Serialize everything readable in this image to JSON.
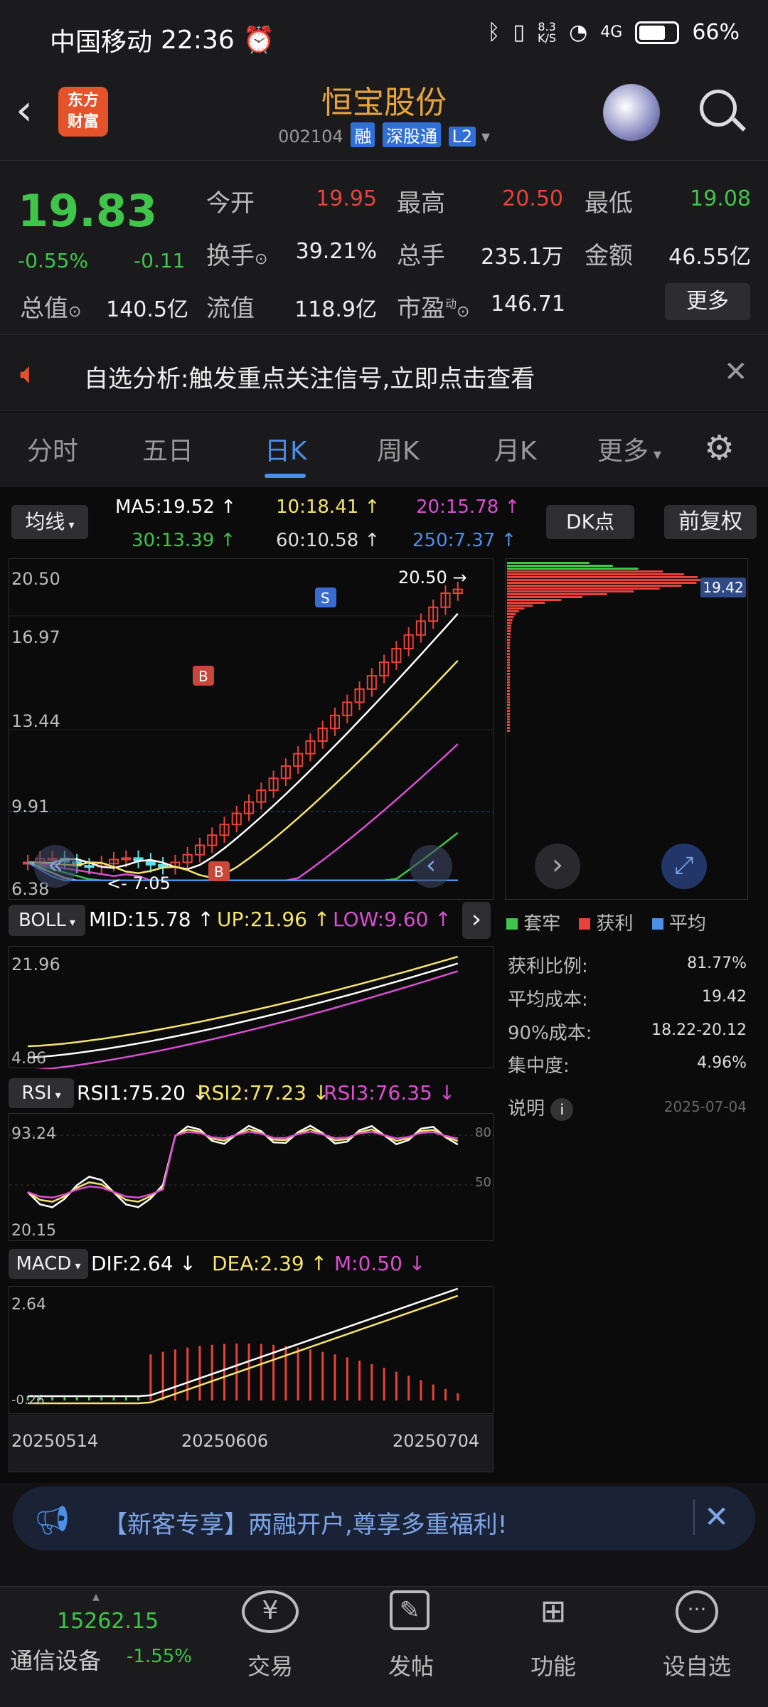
{
  "status": {
    "carrier": "中国移动",
    "time": "22:36",
    "net_speed_top": "8.3",
    "net_speed_unit": "K/S",
    "network": "4G",
    "battery": "66%"
  },
  "header": {
    "logo_line1": "东方",
    "logo_line2": "财富",
    "stock_name": "恒宝股份",
    "stock_code": "002104",
    "tag_rong": "融",
    "tag_shen": "深股通",
    "tag_level": "L2"
  },
  "quote": {
    "price": "19.83",
    "pct_change": "-0.55%",
    "abs_change": "-0.11",
    "open_label": "今开",
    "open_value": "19.95",
    "high_label": "最高",
    "high_value": "20.50",
    "low_label": "最低",
    "low_value": "19.08",
    "turnover_label": "换手",
    "turnover_value": "39.21%",
    "volume_label": "总手",
    "volume_value": "235.1万",
    "amount_label": "金额",
    "amount_value": "46.55亿",
    "mktcap_label": "总值",
    "mktcap_value": "140.5亿",
    "float_label": "流值",
    "float_value": "118.9亿",
    "pe_label": "市盈",
    "pe_sup": "动",
    "pe_value": "146.71",
    "more_label": "更多"
  },
  "notice": {
    "text": "自选分析:触发重点关注信号,立即点击查看"
  },
  "tabs": [
    "分时",
    "五日",
    "日K",
    "周K",
    "月K",
    "更多"
  ],
  "active_tab": "日K",
  "ma_panel": {
    "selector": "均线",
    "ma5": "MA5:19.52",
    "ma10": "10:18.41",
    "ma20": "20:15.78",
    "ma30": "30:13.39",
    "ma60": "60:10.58",
    "ma250": "250:7.37",
    "dk_button": "DK点",
    "fq_button": "前复权",
    "y_labels": [
      "20.50",
      "16.97",
      "13.44",
      "9.91",
      "6.38"
    ],
    "high_marker": "20.50",
    "low_marker": "7.05",
    "chip_price": "19.42"
  },
  "chart_data": {
    "type": "candlestick",
    "ylim": [
      6.38,
      20.5
    ],
    "ma_values": {
      "MA5": 19.52,
      "MA10": 18.41,
      "MA20": 15.78,
      "MA30": 13.39,
      "MA60": 10.58,
      "MA250": 7.37
    },
    "x_tick_labels": [
      "20250514",
      "20250606",
      "20250704"
    ],
    "high": 20.5,
    "low": 7.05,
    "last_close": 19.83
  },
  "boll": {
    "selector": "BOLL",
    "mid": "MID:15.78",
    "up": "UP:21.96",
    "low": "LOW:9.60",
    "y_top": "21.96",
    "y_bottom": "4.86"
  },
  "rsi": {
    "selector": "RSI",
    "rsi1": "RSI1:75.20",
    "rsi2": "RSI2:77.23",
    "rsi3": "RSI3:76.35",
    "y_top": "93.24",
    "y_bottom": "20.15",
    "level_80": "80",
    "level_50": "50"
  },
  "macd": {
    "selector": "MACD",
    "dif": "DIF:2.64",
    "dea": "DEA:2.39",
    "m": "M:0.50",
    "y_top": "2.64",
    "y_bottom": "-0.26"
  },
  "dates": [
    "20250514",
    "20250606",
    "20250704"
  ],
  "chips": {
    "legend_trapped": "套牢",
    "legend_profit": "获利",
    "legend_avg": "平均",
    "profit_ratio_label": "获利比例:",
    "profit_ratio_value": "81.77%",
    "avg_cost_label": "平均成本:",
    "avg_cost_value": "19.42",
    "cost90_label": "90%成本:",
    "cost90_value": "18.22-20.12",
    "concentration_label": "集中度:",
    "concentration_value": "4.96%",
    "explain_label": "说明",
    "date": "2025-07-04"
  },
  "promo": {
    "text": "【新客专享】两融开户,尊享多重福利!"
  },
  "bottom_nav": {
    "index_value": "15262.15",
    "index_name": "通信设备",
    "index_change": "-1.55%",
    "trade": "交易",
    "post": "发帖",
    "function": "功能",
    "watchlist": "设自选"
  },
  "colors": {
    "up": "#e8423a",
    "down": "#3fc54a",
    "accent": "#4c8fe6",
    "brand": "#e5532b",
    "title": "#e8a43a"
  }
}
